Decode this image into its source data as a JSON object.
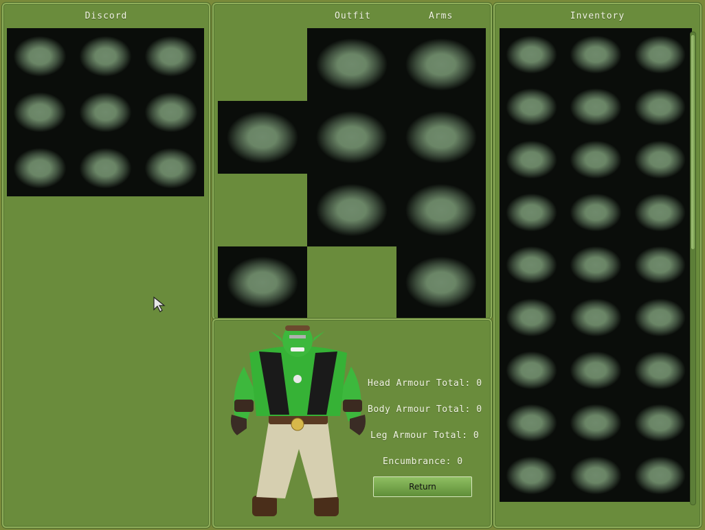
{
  "discord": {
    "title": "Discord",
    "slots": 9
  },
  "outfit": {
    "title_outfit": "Outfit",
    "title_arms": "Arms"
  },
  "stats": {
    "head": "Head Armour Total: 0",
    "body": "Body Armour Total: 0",
    "leg": "Leg Armour Total: 0",
    "encumbrance": "Encumbrance: 0"
  },
  "return_label": "Return",
  "inventory": {
    "title": "Inventory",
    "slots": 27
  },
  "colors": {
    "panel": "#6a8c3c",
    "slot_center": "#6f8a6c",
    "button": "#7aab4c"
  }
}
